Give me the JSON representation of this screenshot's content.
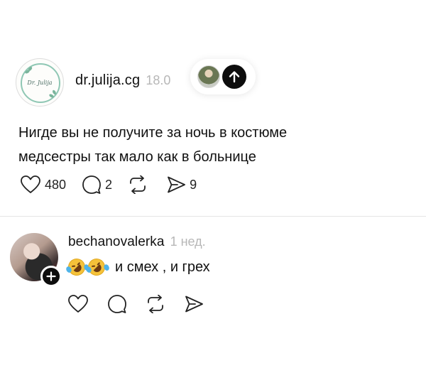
{
  "post": {
    "author": "dr.julija.cg",
    "meta": "18.0",
    "avatar_logo_text": "Dr. Julija",
    "text_lines": [
      "Нигде вы не получите за ночь в костюме",
      "медсестры так мало как в больнице"
    ],
    "likes": "480",
    "comments": "2",
    "shares": "9",
    "icons": [
      "heart-icon",
      "comment-icon",
      "repost-icon",
      "share-icon",
      "arrow-up-icon"
    ]
  },
  "reply": {
    "author": "bechanovalerka",
    "meta": "1 нед.",
    "text": "и смех , и грех",
    "emoji": [
      "rolling-on-floor-laughing-emoji",
      "rolling-on-floor-laughing-emoji"
    ],
    "icons": [
      "heart-icon",
      "comment-icon",
      "repost-icon",
      "share-icon",
      "plus-icon"
    ]
  },
  "colors": {
    "background": "#ffffff",
    "text": "#111111",
    "muted": "#b7b7b7",
    "accent_dark": "#0d0d0d",
    "divider": "#e4e4e4"
  }
}
